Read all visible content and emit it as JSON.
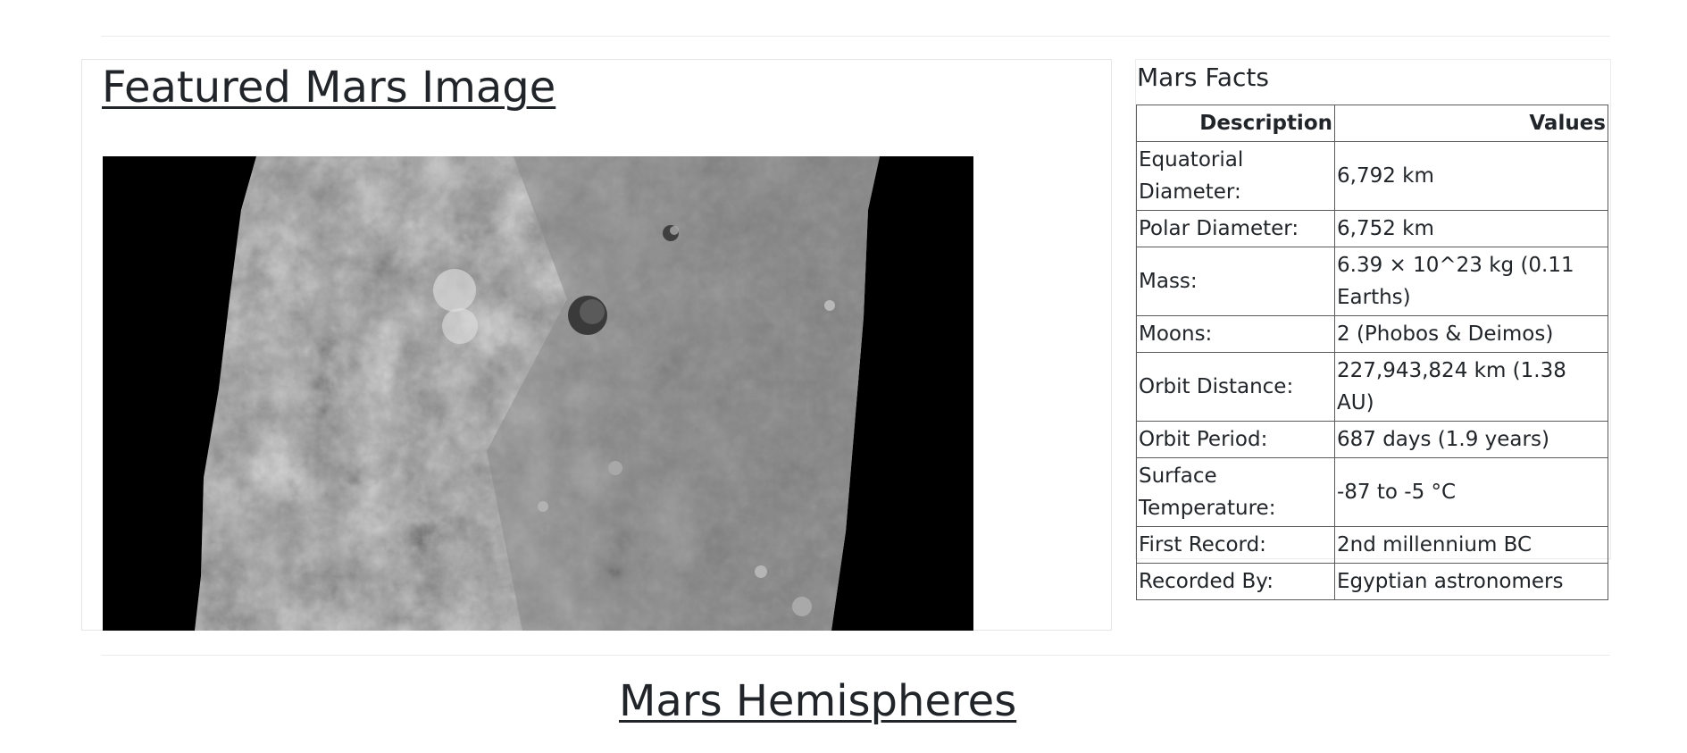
{
  "featured": {
    "title": "Featured Mars Image",
    "image_alt": "Mars surface image"
  },
  "facts": {
    "title": "Mars Facts",
    "headers": [
      "Description",
      "Values"
    ],
    "rows": [
      {
        "label": "Equatorial Diameter:",
        "value": "6,792 km"
      },
      {
        "label": "Polar Diameter:",
        "value": "6,752 km"
      },
      {
        "label": "Mass:",
        "value": "6.39 × 10^23 kg (0.11 Earths)"
      },
      {
        "label": "Moons:",
        "value": "2 (Phobos & Deimos)"
      },
      {
        "label": "Orbit Distance:",
        "value": "227,943,824 km (1.38 AU)"
      },
      {
        "label": "Orbit Period:",
        "value": "687 days (1.9 years)"
      },
      {
        "label": "Surface Temperature:",
        "value": "-87 to -5 °C"
      },
      {
        "label": "First Record:",
        "value": "2nd millennium BC"
      },
      {
        "label": "Recorded By:",
        "value": "Egyptian astronomers"
      }
    ]
  },
  "hemispheres": {
    "title": "Mars Hemispheres"
  }
}
